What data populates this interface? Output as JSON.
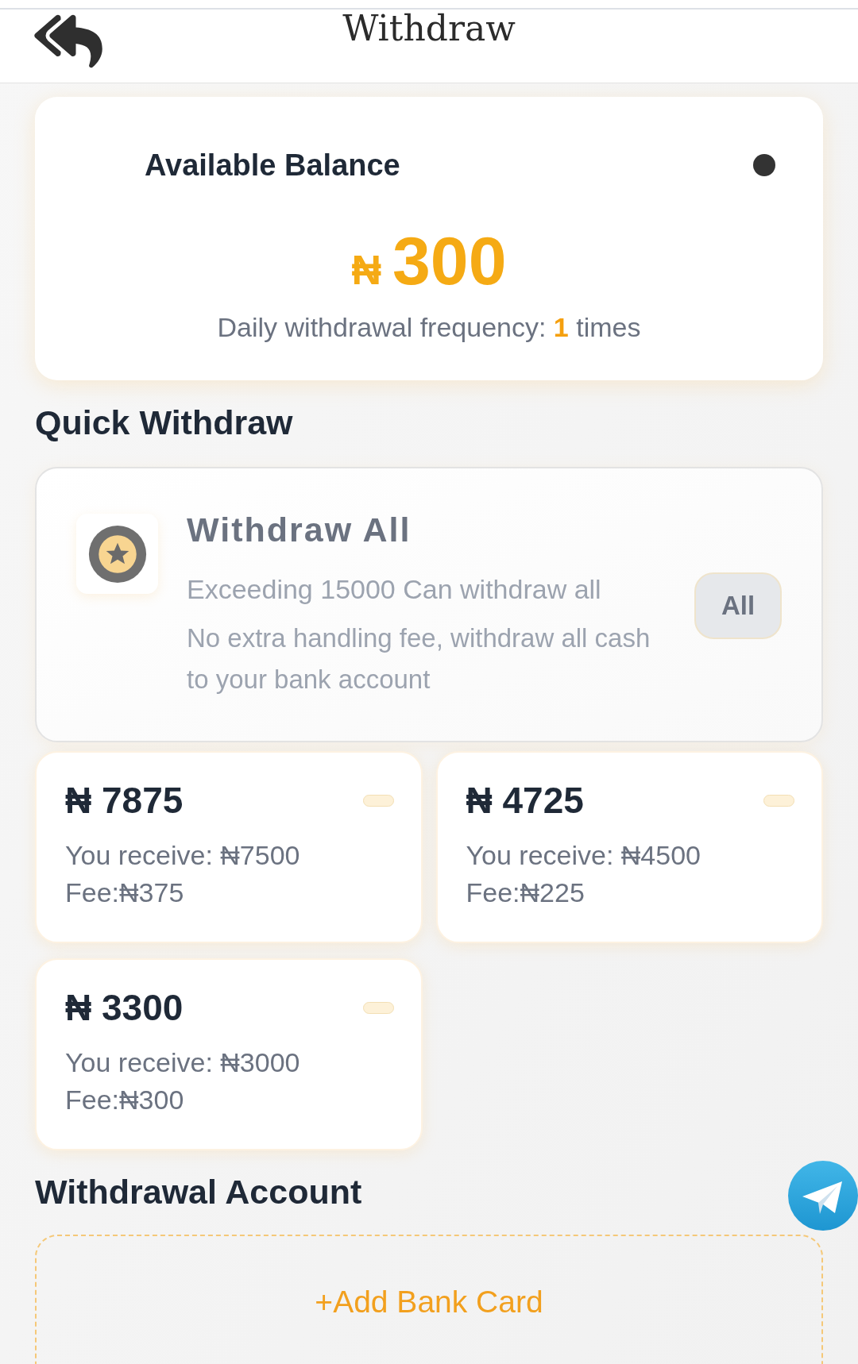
{
  "header": {
    "title": "Withdraw"
  },
  "balance_card": {
    "label": "Available Balance",
    "currency": "₦",
    "amount": "300",
    "frequency": {
      "label": "Daily withdrawal frequency:",
      "count": "1",
      "unit": "times"
    }
  },
  "quick_withdraw": {
    "title": "Quick Withdraw",
    "withdraw_all": {
      "title": "Withdraw All",
      "condition": "Exceeding 15000 Can withdraw all",
      "description": "No extra handling fee, withdraw all cash to your bank account",
      "button": "All"
    },
    "options": [
      {
        "amount": "₦ 7875",
        "receive": "You receive: ₦7500",
        "fee": "Fee:₦375"
      },
      {
        "amount": "₦ 4725",
        "receive": "You receive: ₦4500",
        "fee": "Fee:₦225"
      },
      {
        "amount": "₦ 3300",
        "receive": "You receive: ₦3000",
        "fee": "Fee:₦300"
      }
    ]
  },
  "withdrawal_account": {
    "title": "Withdrawal Account",
    "add_button": "+Add Bank Card"
  }
}
